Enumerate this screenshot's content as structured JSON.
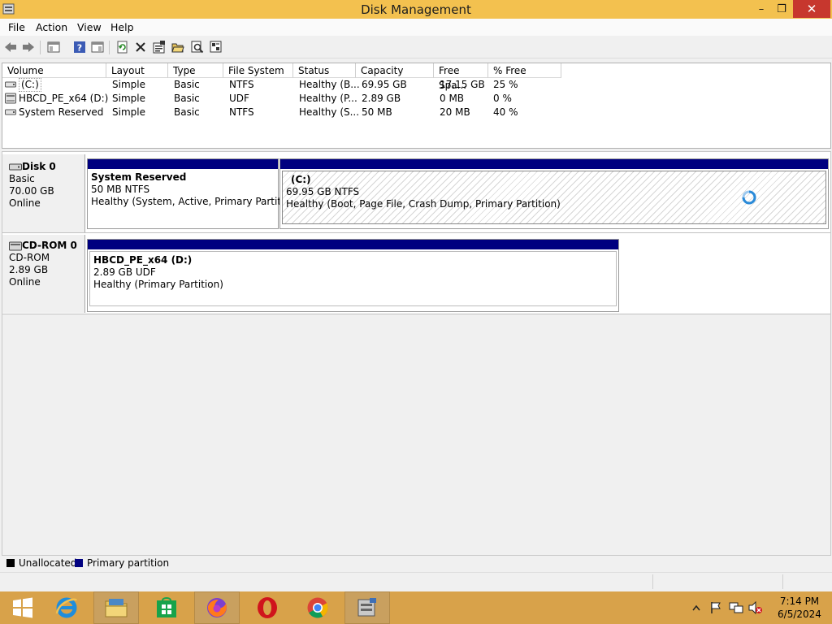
{
  "window": {
    "title": "Disk Management",
    "min": "–",
    "max": "❐",
    "close": "✕"
  },
  "menu": [
    "File",
    "Action",
    "View",
    "Help"
  ],
  "table": {
    "headers": [
      "Volume",
      "Layout",
      "Type",
      "File System",
      "Status",
      "Capacity",
      "Free Spa...",
      "% Free"
    ],
    "rows": [
      [
        "(C:)",
        "Simple",
        "Basic",
        "NTFS",
        "Healthy (B...",
        "69.95 GB",
        "17.15 GB",
        "25 %"
      ],
      [
        "HBCD_PE_x64 (D:)",
        "Simple",
        "Basic",
        "UDF",
        "Healthy (P...",
        "2.89 GB",
        "0 MB",
        "0 %"
      ],
      [
        "System Reserved",
        "Simple",
        "Basic",
        "NTFS",
        "Healthy (S...",
        "50 MB",
        "20 MB",
        "40 %"
      ]
    ]
  },
  "disks": [
    {
      "name": "Disk 0",
      "type": "Basic",
      "size": "70.00 GB",
      "state": "Online",
      "partitions": [
        {
          "name": "System Reserved",
          "fs": "50 MB NTFS",
          "status": "Healthy (System, Active, Primary Partition"
        },
        {
          "name": "(C:)",
          "fs": "69.95 GB NTFS",
          "status": "Healthy (Boot, Page File, Crash Dump, Primary Partition)"
        }
      ]
    },
    {
      "name": "CD-ROM 0",
      "type": "CD-ROM",
      "size": "2.89 GB",
      "state": "Online",
      "partitions": [
        {
          "name": "HBCD_PE_x64  (D:)",
          "fs": "2.89 GB UDF",
          "status": "Healthy (Primary Partition)"
        }
      ]
    }
  ],
  "legend": {
    "unallocated": "Unallocated",
    "primary": "Primary partition"
  },
  "colors": {
    "titlebar": "#f3c14f",
    "taskbar": "#d8a24a",
    "primary_partition": "#000080",
    "unallocated": "#000000",
    "close": "#c7372e"
  },
  "taskbar": {
    "apps": [
      "start-button",
      "internet-explorer-icon",
      "file-explorer-icon",
      "store-icon",
      "firefox-icon",
      "opera-icon",
      "chrome-icon",
      "disk-management-icon"
    ],
    "clock": {
      "time": "7:14 PM",
      "date": "6/5/2024"
    }
  }
}
